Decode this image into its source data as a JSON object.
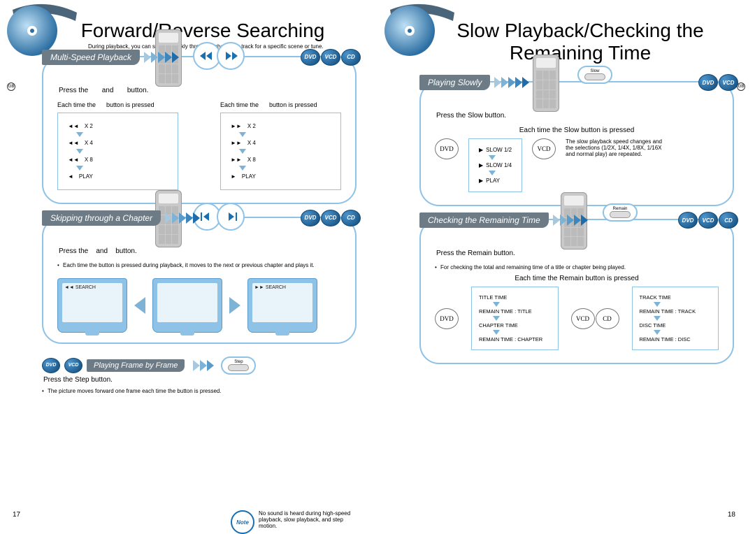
{
  "leftPage": {
    "title": "Forward/Reverse Searching",
    "intro": "During playback, you can search quickly through a chapter or track for a specific scene or tune.",
    "pageNum": "17",
    "gb": "GB",
    "panel1": {
      "title": "Multi-Speed Playback",
      "inst_pre": "Press the",
      "inst_mid": "and",
      "inst_post": "button.",
      "colL_hdr_a": "Each time the",
      "colL_hdr_b": "button is pressed",
      "colR_hdr_a": "Each time the",
      "colR_hdr_b": "button is pressed",
      "speedsL": [
        "X 2",
        "X 4",
        "X 8",
        "PLAY"
      ],
      "speedsR": [
        "X 2",
        "X 4",
        "X 8",
        "PLAY"
      ],
      "discs": [
        "DVD",
        "VCD",
        "CD"
      ]
    },
    "panel2": {
      "title": "Skipping through a Chapter",
      "inst_pre": "Press the",
      "inst_mid": "and",
      "inst_post": "button.",
      "bullet": "Each time the button is pressed during playback, it moves to the next or previous chapter and plays it.",
      "tvL": "SEARCH",
      "tvR": "SEARCH",
      "discs": [
        "DVD",
        "VCD",
        "CD"
      ]
    },
    "frameByFrame": {
      "discs": [
        "DVD",
        "VCD"
      ],
      "title": "Playing Frame by Frame",
      "stepLabel": "Step",
      "inst": "Press the Step button.",
      "bullet": "The picture moves forward one frame each time the button is pressed."
    },
    "note": {
      "label": "Note",
      "text": "No sound is heard during high-speed playback, slow playback, and step motion."
    }
  },
  "rightPage": {
    "titleA": "Slow Playback/Checking the",
    "titleB": "Remaining Time",
    "pageNum": "18",
    "gb": "GB",
    "panel1": {
      "title": "Playing Slowly",
      "inst": "Press the Slow button.",
      "slowLabel": "Slow",
      "hdr": "Each time the Slow button is pressed",
      "discs": [
        "DVD",
        "VCD"
      ],
      "dvdLabel": "DVD",
      "vcdLabel": "VCD",
      "steps": [
        "SLOW 1/2",
        "SLOW 1/4",
        "PLAY"
      ],
      "info": "The slow playback speed changes and the selections (1/2X, 1/4X, 1/8X, 1/16X and normal play) are repeated."
    },
    "panel2": {
      "title": "Checking the Remaining Time",
      "remainLabel": "Remain",
      "inst": "Press the Remain button.",
      "bullet": "For checking the total and remaining time of a title or chapter being played.",
      "hdr": "Each time the Remain button is pressed",
      "discs": [
        "DVD",
        "VCD",
        "CD"
      ],
      "leftDisc": "DVD",
      "rightDiscA": "VCD",
      "rightDiscB": "CD",
      "leftSteps": [
        "TITLE TIME",
        "REMAIN TIME : TITLE",
        "CHAPTER TIME",
        "REMAIN TIME : CHAPTER"
      ],
      "rightSteps": [
        "TRACK TIME",
        "REMAIN TIME : TRACK",
        "DISC TIME",
        "REMAIN TIME : DISC"
      ]
    }
  }
}
